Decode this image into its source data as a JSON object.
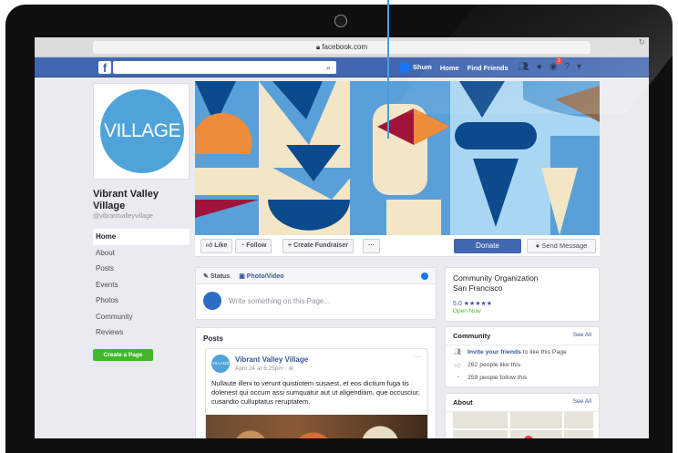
{
  "browser": {
    "url": "facebook.com",
    "lock_icon": "lock-icon"
  },
  "fb_header": {
    "logo": "f",
    "search_placeholder": "",
    "user_name": "Shum",
    "nav": [
      "Home",
      "Find Friends"
    ],
    "notifications_badge": "1",
    "accent": "#4267b2"
  },
  "page": {
    "avatar_text": "VILLAGE",
    "name": "Vibrant Valley Village",
    "handle": "@vibrantvalleyvillage",
    "nav": [
      "Home",
      "About",
      "Posts",
      "Events",
      "Photos",
      "Community",
      "Reviews"
    ],
    "active_nav": "Home",
    "create_page": "Create a Page"
  },
  "actions": {
    "like": "Like",
    "follow": "Follow",
    "fundraiser": "+ Create Fundraiser",
    "more": "···",
    "donate": "Donate",
    "send_message": "Send Message"
  },
  "composer": {
    "status": "Status",
    "photo_video": "Photo/Video",
    "placeholder": "Write something on this Page..."
  },
  "posts": {
    "title": "Posts",
    "items": [
      {
        "author": "Vibrant Valley Village",
        "avatar_text": "VILLAGE",
        "date": "April 24 at 6:25pm · ⊕",
        "text": "Nullaute illeni to verunt quistiotem susaest, et eos dictium fuga tis dolenest qui occum assi sumquatur aut ut aligendiam, que occusciur, cusandio culluptatus reruptatem."
      }
    ]
  },
  "info": {
    "category": "Community Organization",
    "city": "San Francisco",
    "rating": "5.0",
    "stars": "★★★★★",
    "open": "Open Now"
  },
  "community": {
    "title": "Community",
    "see_all": "See All",
    "invite_link": "Invite your friends",
    "invite_rest": "to like this Page",
    "likes": "262 people like this",
    "follows": "259 people follow this"
  },
  "about": {
    "title": "About",
    "see_all": "See All"
  }
}
